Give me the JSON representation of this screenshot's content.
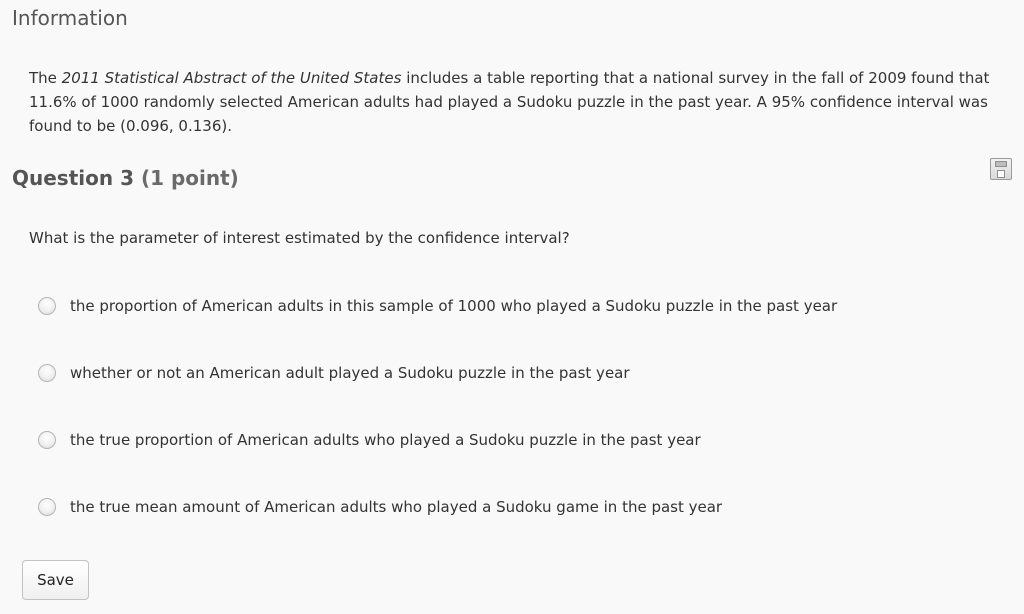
{
  "information": {
    "heading": "Information",
    "text_before_title": "The ",
    "source_title": "2011 Statistical Abstract of the United States",
    "text_after_title": " includes a table reporting that a national survey in the fall of 2009 found that 11.6% of 1000 randomly selected American adults had played a Sudoku puzzle in the past year.  A 95% confidence interval was found to be (0.096, 0.136)."
  },
  "question": {
    "label": "Question 3",
    "points": "(1 point)",
    "prompt": "What is the parameter of interest estimated by the confidence interval?",
    "options": [
      {
        "label": "the proportion of American adults in this sample of 1000 who played a Sudoku puzzle in the past year",
        "selected": false
      },
      {
        "label": "whether or not an American adult played a Sudoku puzzle in the past year",
        "selected": false
      },
      {
        "label": "the true proportion of American adults who played a Sudoku puzzle in the past year",
        "selected": false
      },
      {
        "label": "the true mean amount of American adults who played a Sudoku game in the past year",
        "selected": false
      }
    ]
  },
  "icons": {
    "save_question": "floppy-disk-icon"
  },
  "actions": {
    "save_label": "Save"
  }
}
